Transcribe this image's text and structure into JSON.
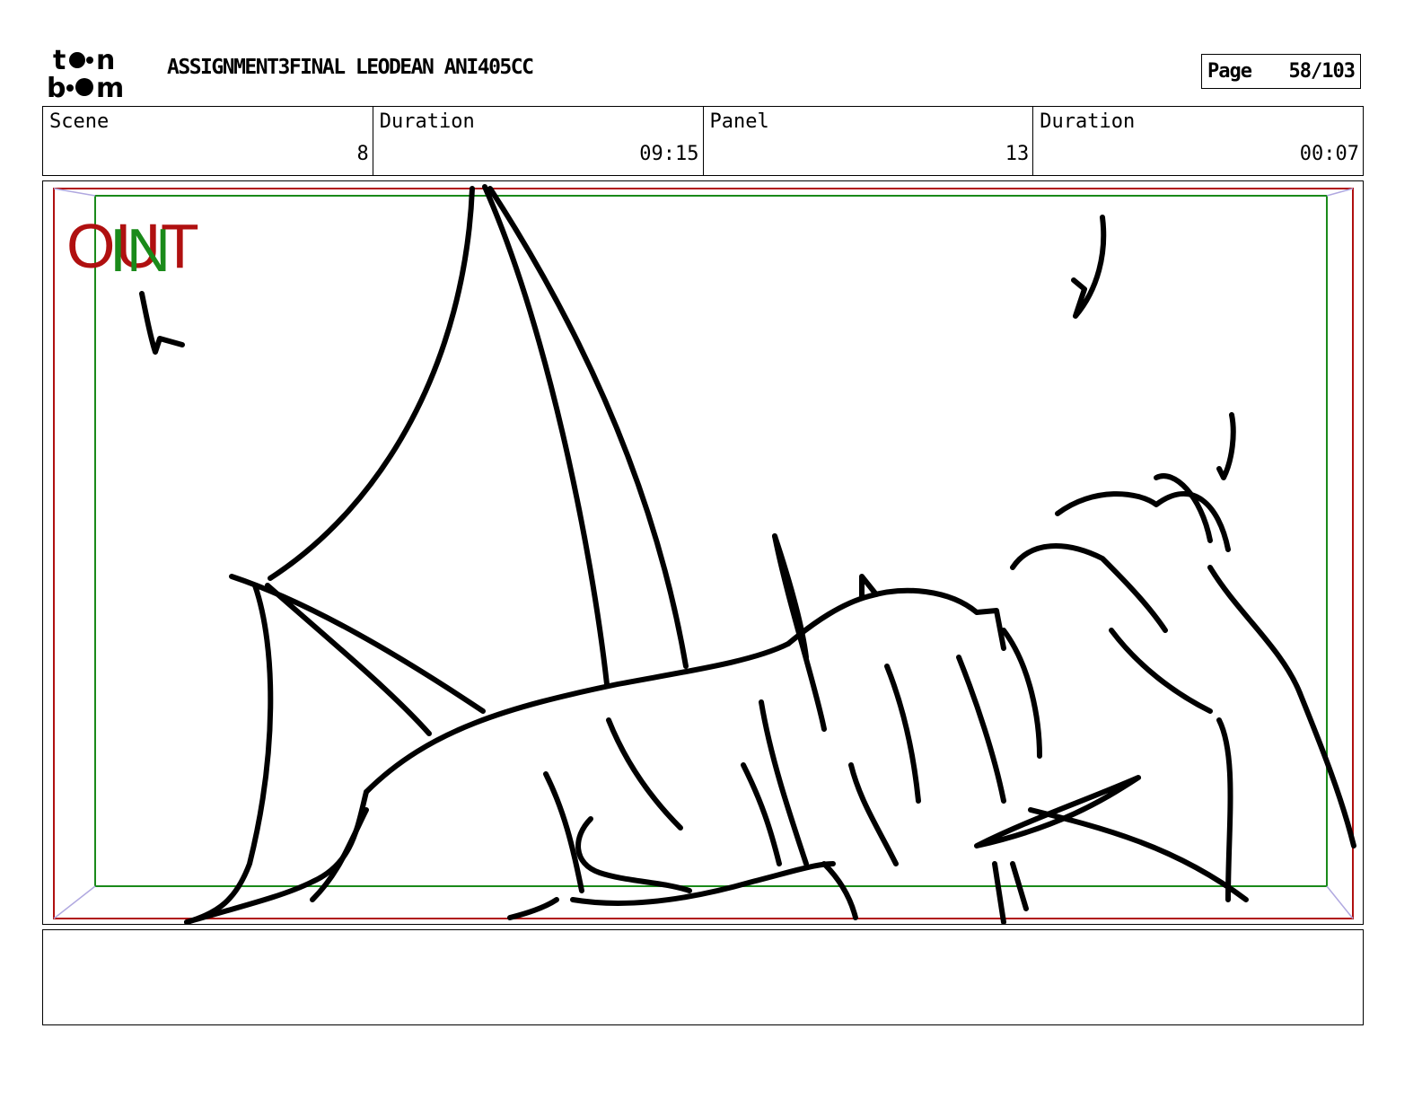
{
  "header": {
    "logo_text": "toon boom",
    "project_title": "ASSIGNMENT3FINAL LEODEAN ANI405CC",
    "page_label": "Page",
    "page_value": "58/103"
  },
  "info": {
    "scene_label": "Scene",
    "scene_value": "8",
    "scene_duration_label": "Duration",
    "scene_duration_value": "09:15",
    "panel_label": "Panel",
    "panel_value": "13",
    "panel_duration_label": "Duration",
    "panel_duration_value": "00:07"
  },
  "panel": {
    "out_label": "OUT",
    "in_label": "IN",
    "colors": {
      "out_frame": "#b01010",
      "in_frame": "#1a8a1a",
      "safe_corner": "#b0a8e0"
    }
  },
  "dialogue": {
    "text": ""
  }
}
